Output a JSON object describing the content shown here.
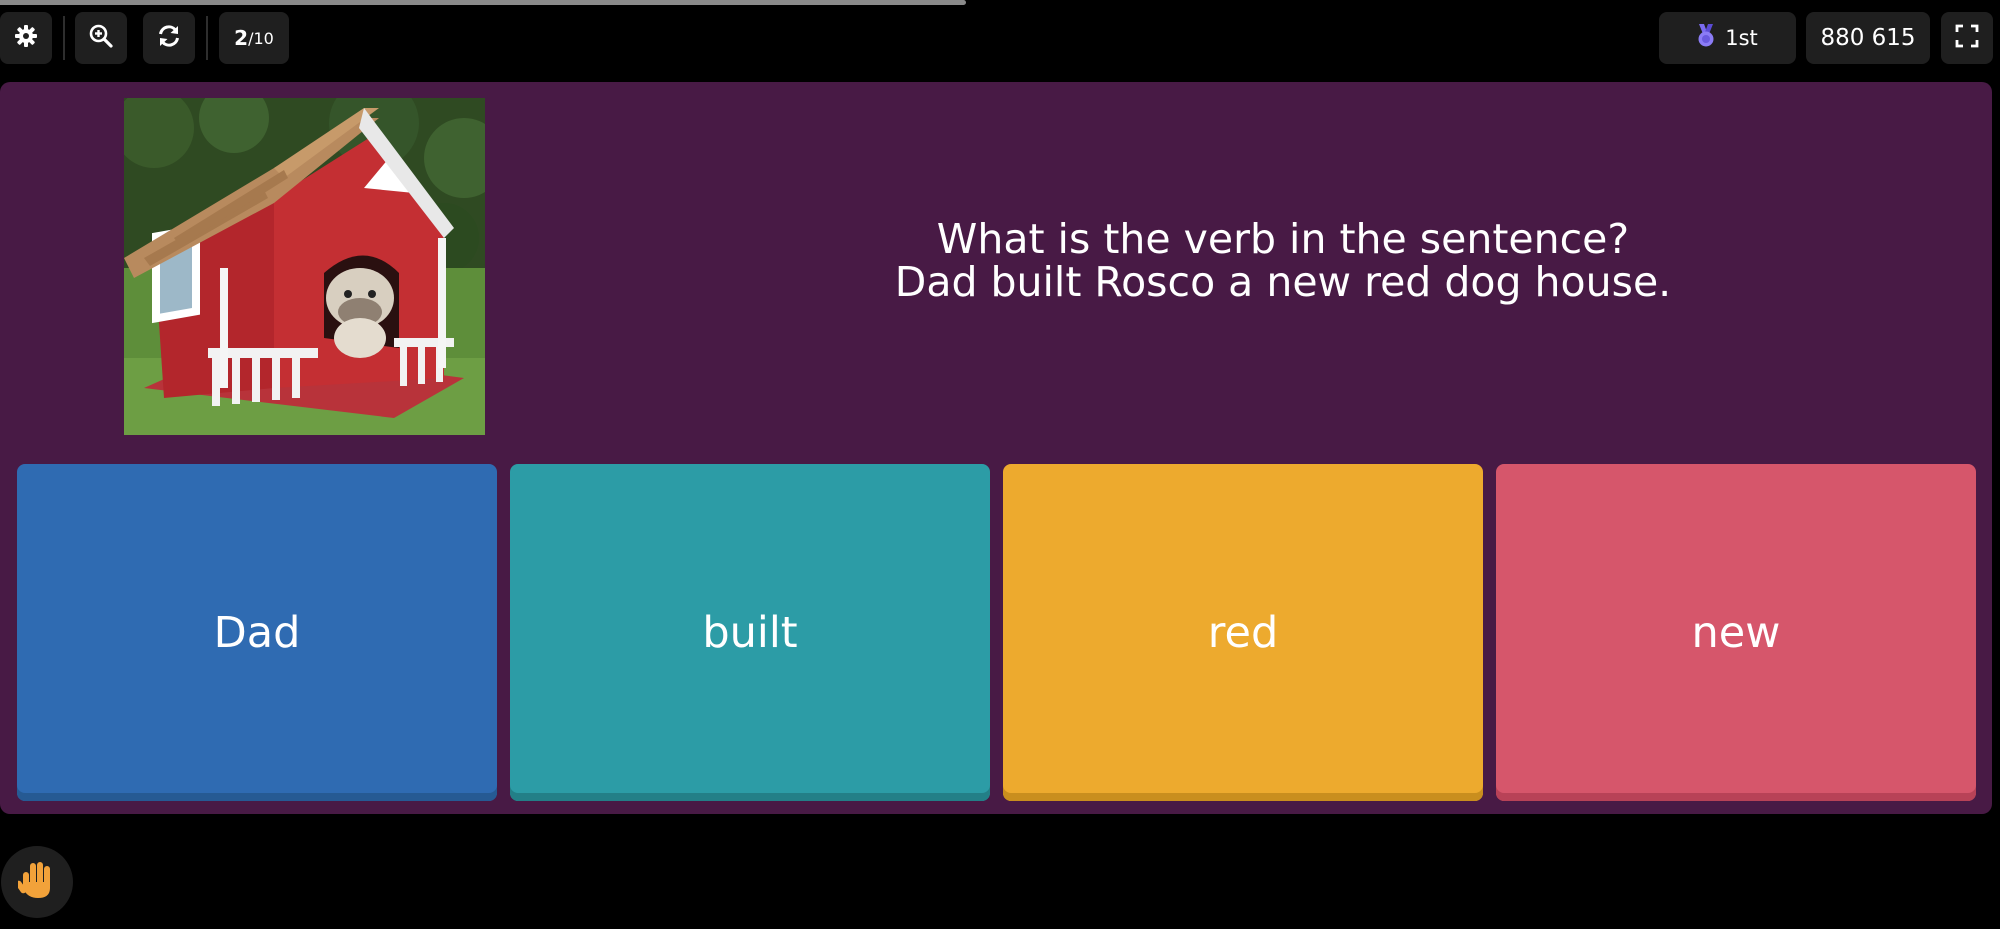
{
  "progress": {
    "fraction": 0.483
  },
  "toolbar": {
    "settings_icon": "gear-icon",
    "zoom_icon": "zoom-in-icon",
    "refresh_icon": "refresh-icon",
    "question_current": "2",
    "question_total": "/10",
    "rank_icon": "medal-icon",
    "rank_label": "1st",
    "score": "880 615",
    "fullscreen_icon": "fullscreen-icon"
  },
  "question": {
    "line1": "What is the verb in the sentence?",
    "line2": "Dad built Rosco a new red dog house."
  },
  "answers": [
    {
      "label": "Dad",
      "color": "#2f6bb2"
    },
    {
      "label": "built",
      "color": "#2c9ca6"
    },
    {
      "label": "red",
      "color": "#edaa2e"
    },
    {
      "label": "new",
      "color": "#d6566b"
    }
  ],
  "footer": {
    "raise_hand_icon": "raise-hand-icon"
  },
  "colors": {
    "panel": "#481a45",
    "background": "#000000",
    "button": "#1f1f1f"
  }
}
